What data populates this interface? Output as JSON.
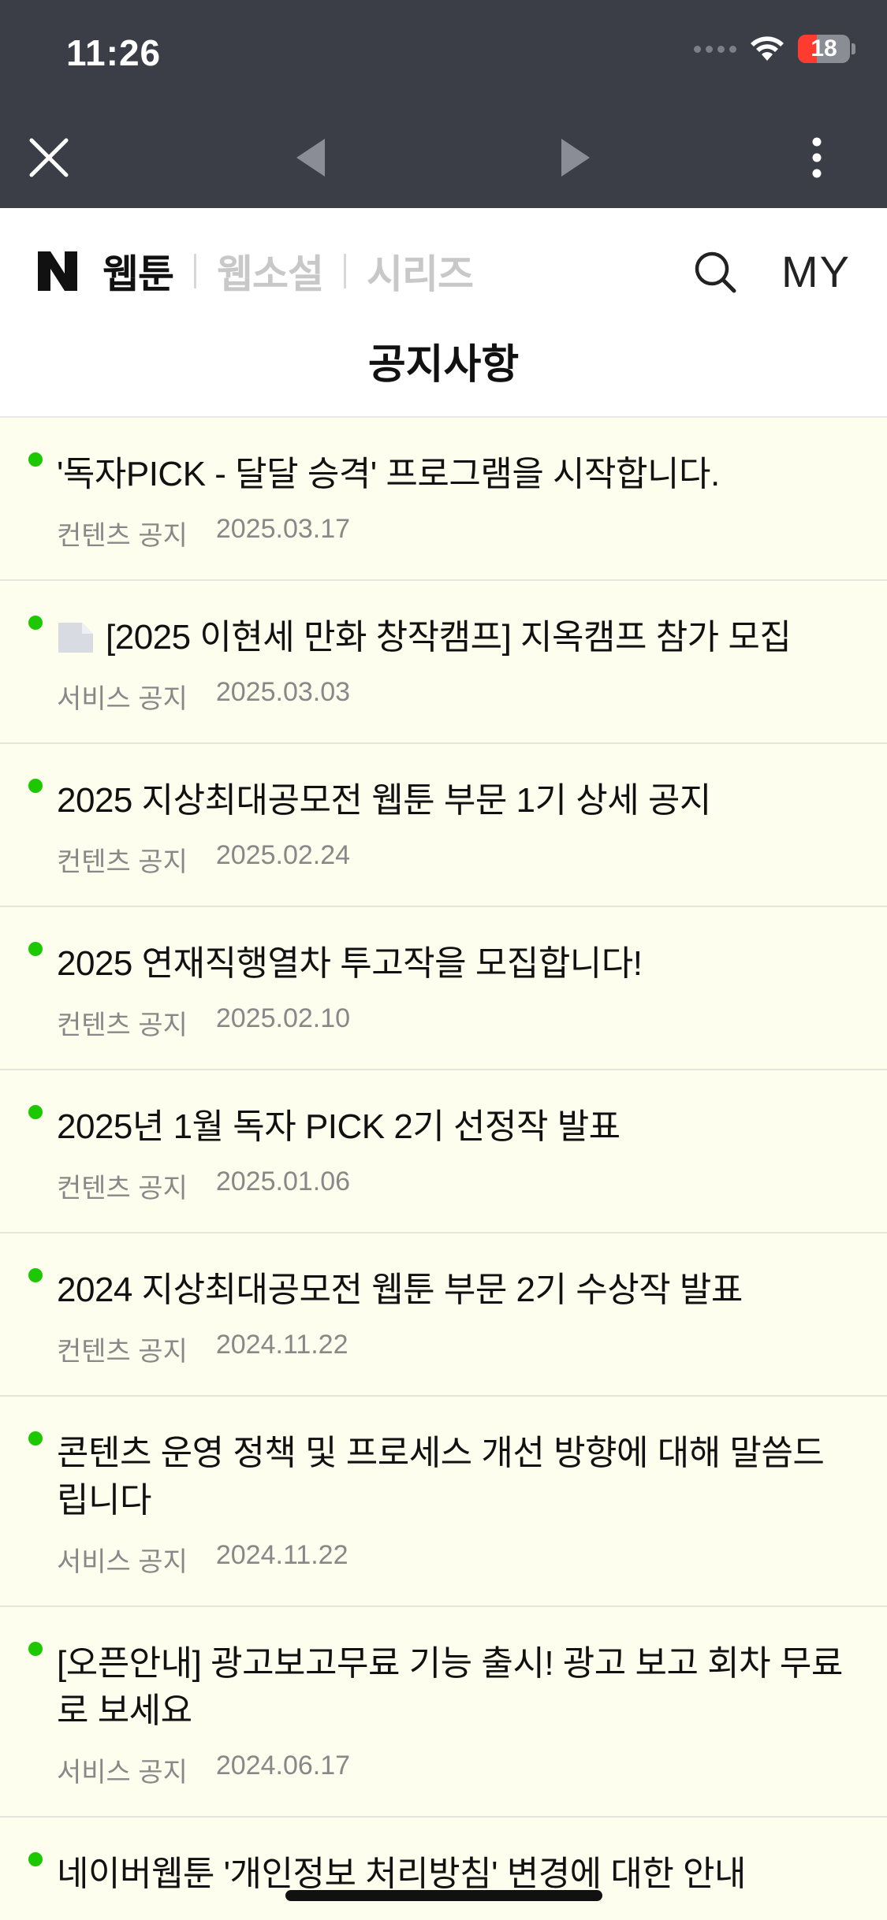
{
  "status": {
    "time": "11:26",
    "battery": "18",
    "colors": {
      "battery_low": "#ff3b30"
    }
  },
  "browser": {
    "close_icon": "close-icon",
    "back_icon": "back-arrow-icon",
    "forward_icon": "forward-arrow-icon",
    "menu_icon": "more-vertical-icon"
  },
  "header": {
    "logo_letter": "N",
    "tabs": [
      "웹툰",
      "웹소설",
      "시리즈"
    ],
    "my_label": "MY",
    "page_title": "공지사항",
    "colors": {
      "accent": "#1ec800",
      "inactive_tab": "#c8c8c8"
    }
  },
  "notices": [
    {
      "title": "'독자PICK - 달달 승격' 프로그램을 시작합니다.",
      "category": "컨텐츠 공지",
      "date": "2025.03.17"
    },
    {
      "title": "[2025 이현세 만화 창작캠프] 지옥캠프 참가 모집",
      "category": "서비스 공지",
      "date": "2025.03.03",
      "icon": "file-icon"
    },
    {
      "title": "2025 지상최대공모전 웹툰 부문 1기 상세 공지",
      "category": "컨텐츠 공지",
      "date": "2025.02.24"
    },
    {
      "title": "2025 연재직행열차 투고작을 모집합니다!",
      "category": "컨텐츠 공지",
      "date": "2025.02.10"
    },
    {
      "title": "2025년 1월 독자 PICK 2기 선정작 발표",
      "category": "컨텐츠 공지",
      "date": "2025.01.06"
    },
    {
      "title": "2024 지상최대공모전 웹툰 부문 2기 수상작 발표",
      "category": "컨텐츠 공지",
      "date": "2024.11.22"
    },
    {
      "title": "콘텐츠 운영 정책 및 프로세스 개선 방향에 대해 말씀드립니다",
      "category": "서비스 공지",
      "date": "2024.11.22"
    },
    {
      "title": "[오픈안내] 광고보고무료 기능 출시! 광고 보고 회차 무료로 보세요",
      "category": "서비스 공지",
      "date": "2024.06.17"
    },
    {
      "title": "네이버웹툰 '개인정보 처리방침' 변경에 대한 안내",
      "category": "",
      "date": ""
    }
  ]
}
